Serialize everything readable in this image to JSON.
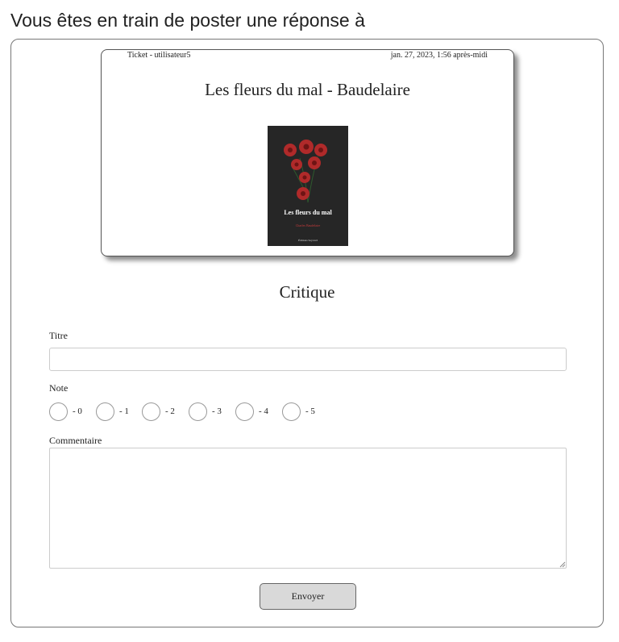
{
  "page": {
    "heading": "Vous êtes en train de poster une réponse à"
  },
  "ticket": {
    "author_line": "Ticket - utilisateur5",
    "date": "jan. 27, 2023, 1:56 après-midi",
    "title": "Les fleurs du mal - Baudelaire",
    "cover": {
      "title": "Les fleurs du mal",
      "author": "Charles Baudelaire",
      "publisher": "Éditions Seyvard",
      "background_color": "#262626",
      "rose_color": "#b02a2a"
    }
  },
  "form": {
    "section_title": "Critique",
    "title_label": "Titre",
    "title_value": "",
    "rating_label": "Note",
    "rating_options": [
      "- 0",
      "- 1",
      "- 2",
      "- 3",
      "- 4",
      "- 5"
    ],
    "rating_selected": null,
    "comment_label": "Commentaire",
    "comment_value": "",
    "submit_label": "Envoyer"
  }
}
